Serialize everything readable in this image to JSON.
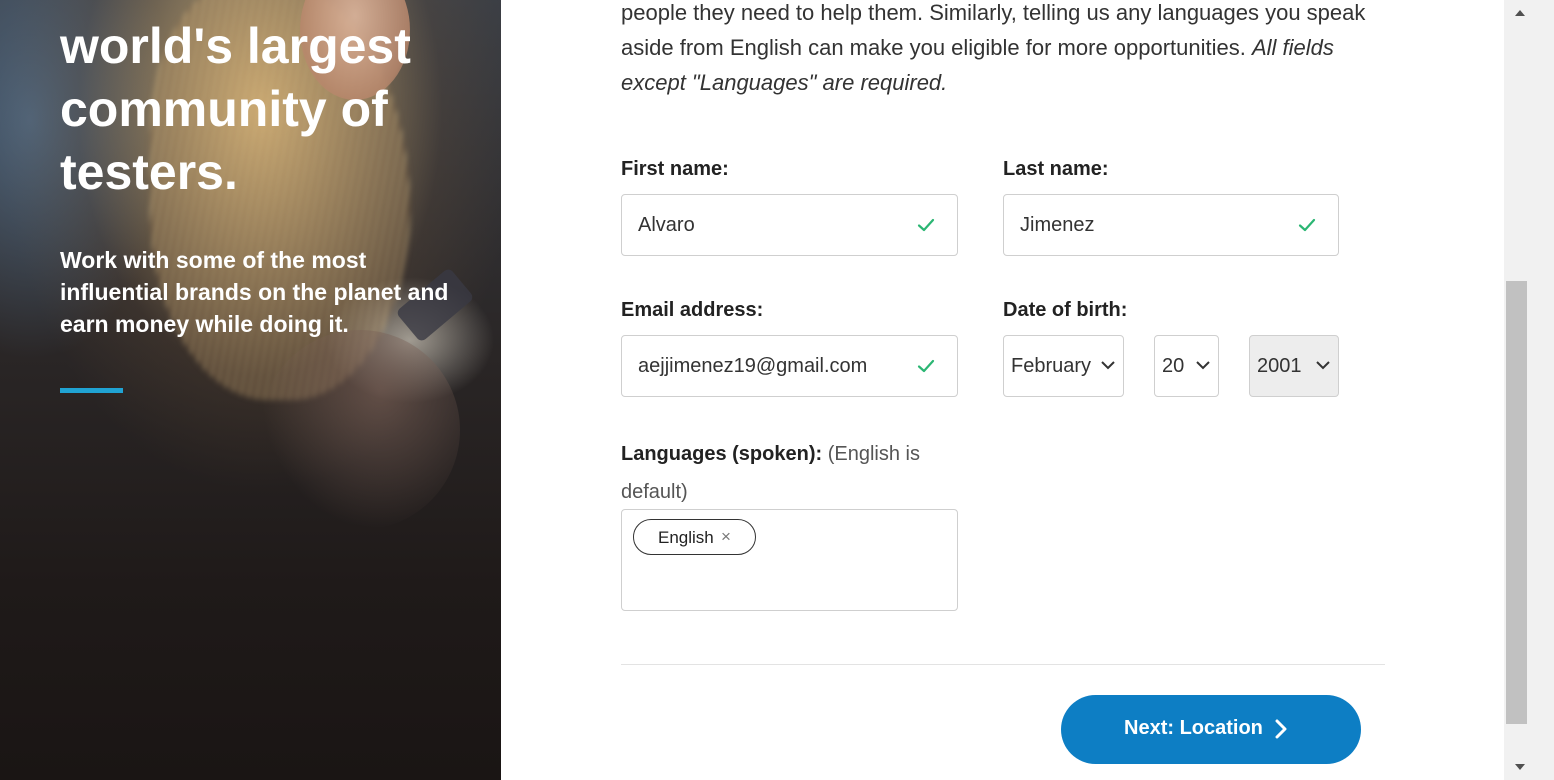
{
  "hero": {
    "heading": "world's largest community of testers.",
    "subheading": "Work with some of the most influential brands on the planet and earn money while doing it.",
    "accent_color": "#20a3d3"
  },
  "intro": {
    "text": "people they need to help them. Similarly, telling us any languages you speak aside from English can make you eligible for more opportunities.",
    "note": "All fields except \"Languages\" are required."
  },
  "form": {
    "first_name": {
      "label": "First name:",
      "value": "Alvaro",
      "valid": true
    },
    "last_name": {
      "label": "Last name:",
      "value": "Jimenez",
      "valid": true
    },
    "email": {
      "label": "Email address:",
      "value": "aejjimenez19@gmail.com",
      "valid": true
    },
    "dob": {
      "label": "Date of birth:",
      "month": "February",
      "day": "20",
      "year": "2001"
    },
    "languages": {
      "label": "Languages (spoken):",
      "note": "(English is default)",
      "tags": [
        {
          "label": "English",
          "remove": "×"
        }
      ]
    }
  },
  "actions": {
    "next_label": "Next: Location",
    "button_color": "#0d7ec4"
  },
  "colors": {
    "valid_check": "#2bb673"
  }
}
